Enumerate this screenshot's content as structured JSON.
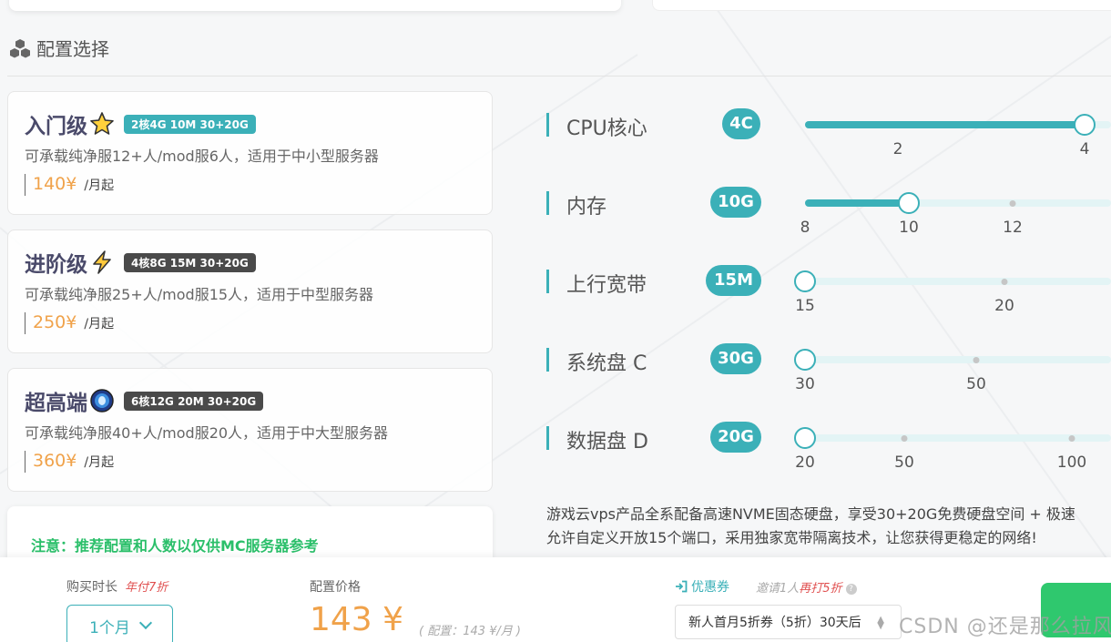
{
  "section": {
    "title": "配置选择",
    "icon": "cubes-icon"
  },
  "plans": [
    {
      "name": "入门级",
      "icon": "star-icon",
      "badge": "2核4G 10M 30+20G",
      "badge_color": "#3bb0b8",
      "desc": "可承载纯净服12+人/mod服6人，适用于中小型服务器",
      "price": "140¥",
      "unit": "/月起"
    },
    {
      "name": "进阶级",
      "icon": "lightning-icon",
      "badge": "4核8G 15M 30+20G",
      "badge_color": "#4a4a4a",
      "desc": "可承载纯净服25+人/mod服15人，适用于中型服务器",
      "price": "250¥",
      "unit": "/月起"
    },
    {
      "name": "超高端",
      "icon": "portal-icon",
      "badge": "6核12G 20M 30+20G",
      "badge_color": "#4a4a4a",
      "desc": "可承载纯净服40+人/mod服20人，适用于中大型服务器",
      "price": "360¥",
      "unit": "/月起"
    }
  ],
  "notice": "注意：推荐配置和人数以仅供MC服务器参考",
  "config": [
    {
      "label": "CPU核心",
      "value": "4C",
      "ticks": [
        "2",
        "4"
      ],
      "current": 4,
      "min": 2,
      "max": 4
    },
    {
      "label": "内存",
      "value": "10G",
      "ticks": [
        "8",
        "10",
        "12"
      ],
      "current": 10,
      "min": 8,
      "max": 12
    },
    {
      "label": "上行宽带",
      "value": "15M",
      "ticks": [
        "15",
        "20"
      ],
      "current": 15,
      "min": 15,
      "max": 20
    },
    {
      "label": "系统盘 C",
      "value": "30G",
      "ticks": [
        "30",
        "50"
      ],
      "current": 30,
      "min": 30,
      "max": 50
    },
    {
      "label": "数据盘 D",
      "value": "20G",
      "ticks": [
        "20",
        "50",
        "100"
      ],
      "current": 20,
      "min": 20,
      "max": 100
    }
  ],
  "info": {
    "line1": "游戏云vps产品全系配备高速NVME固态硬盘，享受30+20G免费硬盘空间 + 极速",
    "line2": "允许自定义开放15个端口，采用独家宽带隔离技术，让您获得更稳定的网络!"
  },
  "bottom": {
    "duration_label": "购买时长",
    "duration_hint": "年付7折",
    "duration_value": "1个月",
    "price_label": "配置价格",
    "price_value": "143 ¥",
    "price_detail": "( 配置：143 ¥/月 )",
    "coupon_label": "优惠券",
    "invite_prefix": "邀请1人",
    "invite_highlight": "再打5折",
    "coupon_value": "新人首月5折券（5折）30天后"
  },
  "watermark": "CSDN @还是那么拉风"
}
